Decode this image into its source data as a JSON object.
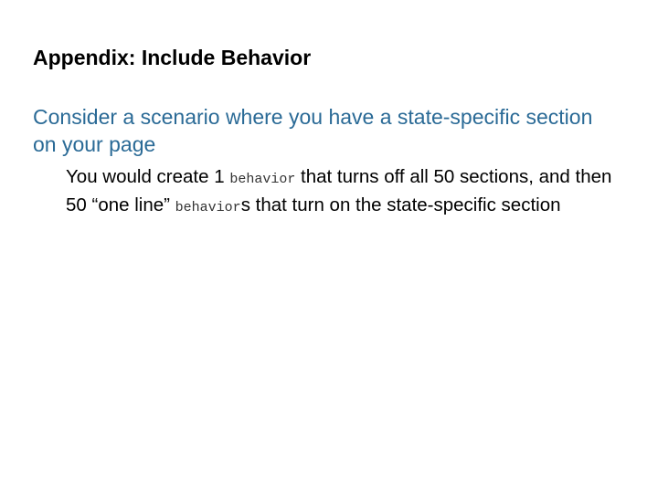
{
  "slide": {
    "title": "Appendix: Include Behavior",
    "lead": "Consider a scenario where you have a state-specific section on your page",
    "detail": {
      "part1": "You would create 1 ",
      "code1": "behavior",
      "part2": " that turns off all 50 sections, and then 50 “one line” ",
      "code2": "behavior",
      "part3": "s that turn on the state-specific section"
    },
    "colors": {
      "lead_text": "#2a6a96",
      "title_text": "#000000"
    }
  }
}
